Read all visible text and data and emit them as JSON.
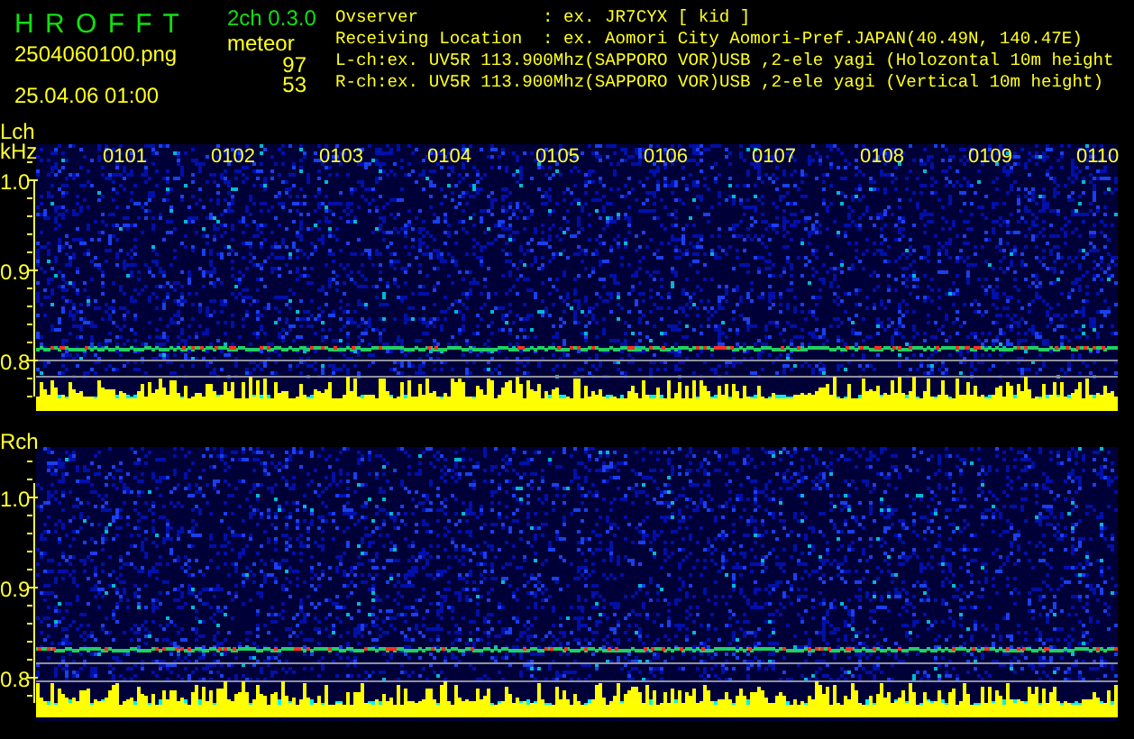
{
  "app": {
    "title": "H R O F F T",
    "version": "2ch 0.3.0"
  },
  "file": {
    "name": "2504060100.png",
    "datetime": "25.04.06 01:00"
  },
  "meteor": {
    "label": "meteor",
    "counts": [
      "97",
      "53"
    ]
  },
  "station": {
    "fields": [
      {
        "label": "Ovserver",
        "value": ": ex. JR7CYX [ kid ]"
      },
      {
        "label": "Receiving Location",
        "value": ": ex. Aomori City Aomori-Pref.JAPAN(40.49N, 140.47E)"
      }
    ],
    "channel_lines": [
      "L-ch:ex. UV5R 113.900Mhz(SAPPORO VOR)USB ,2-ele yagi (Holozontal 10m height",
      "R-ch:ex. UV5R 113.900Mhz(SAPPORO VOR)USB ,2-ele yagi (Vertical 10m height)"
    ]
  },
  "channels": [
    {
      "name": "Lch",
      "unit": "kHz",
      "frequency_labels": [
        "1.0",
        "0.9",
        "0.8"
      ],
      "time_labels": [
        "0101",
        "0102",
        "0103",
        "0104",
        "0105",
        "0106",
        "0107",
        "0108",
        "0109",
        "0110"
      ]
    },
    {
      "name": "Rch",
      "frequency_labels": [
        "1.0",
        "0.9",
        "0.8"
      ]
    }
  ]
}
